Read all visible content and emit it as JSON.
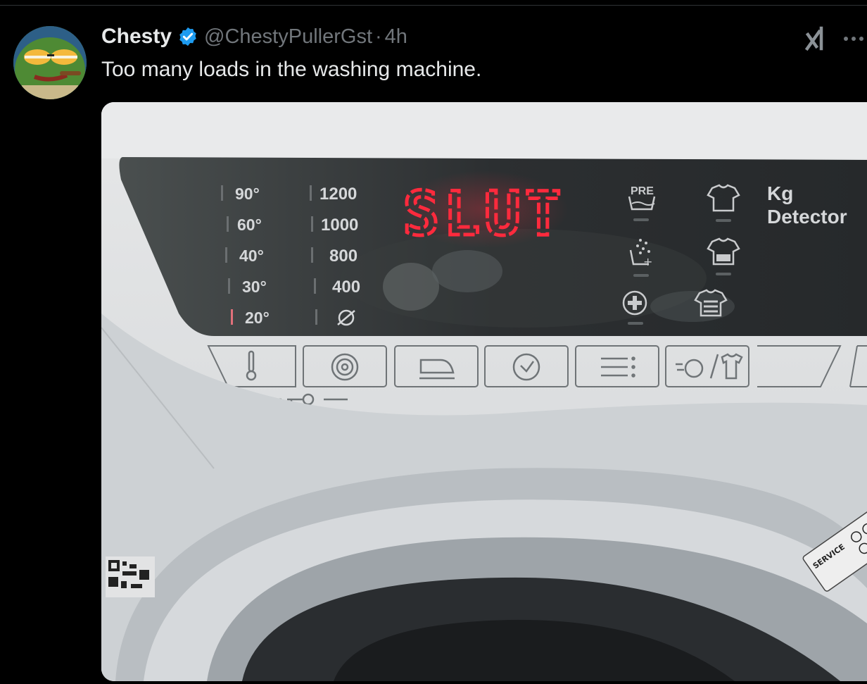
{
  "tweet": {
    "author_name": "Chesty",
    "handle": "@ChestyPullerGst",
    "separator": "·",
    "time": "4h",
    "text": "Too many loads in the washing machine."
  },
  "icons": {
    "verified": "verified-badge-icon",
    "grok": "grok-icon",
    "more": "more-options-icon"
  },
  "colors": {
    "verified_blue": "#1d9bf0",
    "display_red": "#ff2a3d"
  },
  "washer": {
    "display_text": "SLUT",
    "temperatures": [
      "90°",
      "60°",
      "40°",
      "30°",
      "20°"
    ],
    "spin_speeds": [
      "1200",
      "1000",
      "800",
      "400"
    ],
    "pre_label": "PRE",
    "kg_detector": [
      "Kg",
      "Detector"
    ],
    "service_label": "SERVICE"
  }
}
